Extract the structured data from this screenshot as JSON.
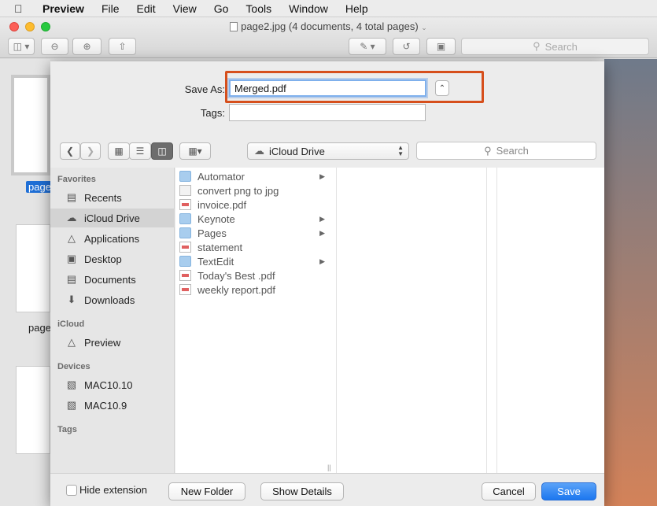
{
  "menubar": {
    "apple_icon": "apple-logo",
    "items": [
      "Preview",
      "File",
      "Edit",
      "View",
      "Go",
      "Tools",
      "Window",
      "Help"
    ]
  },
  "window": {
    "title": "page2.jpg (4 documents, 4 total pages)",
    "search_placeholder": "Search",
    "thumbnail_labels": [
      "page",
      "page"
    ]
  },
  "save_sheet": {
    "save_as_label": "Save As:",
    "save_as_value": "Merged.pdf",
    "tags_label": "Tags:",
    "tags_value": "",
    "location": "iCloud Drive",
    "search_placeholder": "Search",
    "sidebar": {
      "favorites_title": "Favorites",
      "favorites": [
        {
          "label": "Recents",
          "icon": "recents-icon"
        },
        {
          "label": "iCloud Drive",
          "icon": "cloud-icon",
          "selected": true
        },
        {
          "label": "Applications",
          "icon": "applications-icon"
        },
        {
          "label": "Desktop",
          "icon": "desktop-icon"
        },
        {
          "label": "Documents",
          "icon": "documents-icon"
        },
        {
          "label": "Downloads",
          "icon": "downloads-icon"
        }
      ],
      "icloud_title": "iCloud",
      "icloud": [
        {
          "label": "Preview",
          "icon": "preview-app-icon"
        }
      ],
      "devices_title": "Devices",
      "devices": [
        {
          "label": "MAC10.10",
          "icon": "disk-icon"
        },
        {
          "label": "MAC10.9",
          "icon": "disk-icon"
        }
      ],
      "tags_title": "Tags"
    },
    "files": [
      {
        "name": "Automator",
        "type": "folder",
        "has_children": true
      },
      {
        "name": "convert png to jpg",
        "type": "doc",
        "has_children": false
      },
      {
        "name": "invoice.pdf",
        "type": "pdf",
        "has_children": false
      },
      {
        "name": "Keynote",
        "type": "folder",
        "has_children": true
      },
      {
        "name": "Pages",
        "type": "folder",
        "has_children": true
      },
      {
        "name": "statement",
        "type": "pdf",
        "has_children": false
      },
      {
        "name": "TextEdit",
        "type": "folder",
        "has_children": true
      },
      {
        "name": "Today's Best .pdf",
        "type": "pdf",
        "has_children": false
      },
      {
        "name": "weekly report.pdf",
        "type": "pdf",
        "has_children": false
      }
    ],
    "bottom": {
      "hide_extension_label": "Hide extension",
      "hide_extension_checked": false,
      "new_folder_label": "New Folder",
      "show_details_label": "Show Details",
      "cancel_label": "Cancel",
      "save_label": "Save"
    }
  },
  "colors": {
    "highlight": "#d64f1c",
    "primary_button": "#1c77ef",
    "selection": "#1f6fd6"
  }
}
